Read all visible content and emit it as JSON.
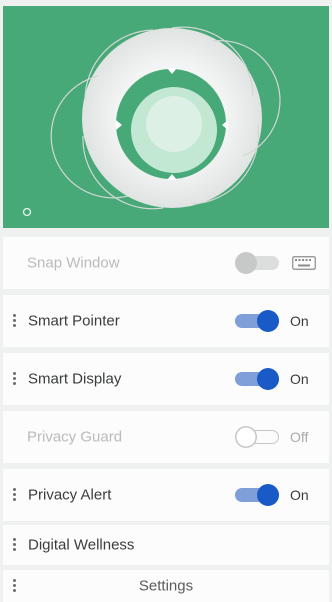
{
  "colors": {
    "hero_bg": "#47a878",
    "toggle_on": "#1a5ac6",
    "toggle_track_on": "#7e9fd8"
  },
  "hero": {
    "logo_icon": "aperture-shutter-icon",
    "corner_icon": "info-icon"
  },
  "rows": [
    {
      "id": "snap-window",
      "label": "Snap Window",
      "enabled": false,
      "toggle": "off",
      "extra_icon": "keyboard-icon"
    },
    {
      "id": "smart-pointer",
      "label": "Smart Pointer",
      "enabled": true,
      "toggle": "on",
      "state": "On"
    },
    {
      "id": "smart-display",
      "label": "Smart Display",
      "enabled": true,
      "toggle": "on",
      "state": "On"
    },
    {
      "id": "privacy-guard",
      "label": "Privacy Guard",
      "enabled": false,
      "toggle": "off",
      "state": "Off"
    },
    {
      "id": "privacy-alert",
      "label": "Privacy Alert",
      "enabled": true,
      "toggle": "on",
      "state": "On"
    },
    {
      "id": "digital-wellness",
      "label": "Digital Wellness",
      "enabled": true
    },
    {
      "id": "settings",
      "label": "Settings",
      "enabled": true
    }
  ]
}
